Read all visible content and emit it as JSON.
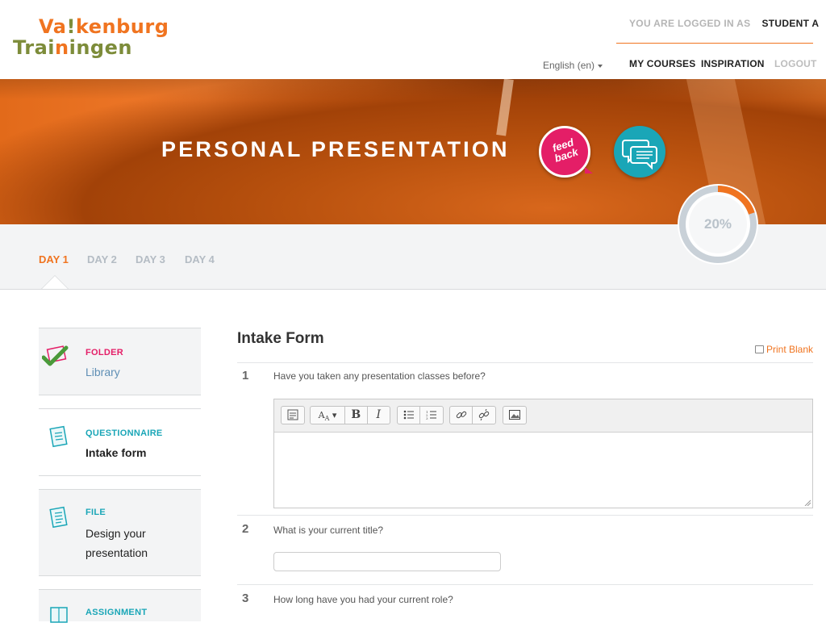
{
  "brand": {
    "line1_a": "Va",
    "line1_bang": "!",
    "line1_b": "kenburg",
    "line2_a": "Trai",
    "line2_i": "n",
    "line2_b": "ingen"
  },
  "header": {
    "logged_in_label": "YOU ARE LOGGED IN AS",
    "user": "STUDENT A",
    "language": "English (en)",
    "nav": {
      "my_courses": "MY COURSES",
      "inspiration": "INSPIRATION",
      "logout": "LOGOUT"
    }
  },
  "hero": {
    "title": "PERSONAL PRESENTATION",
    "feedback_badge": "feed back",
    "chat_icon": "chat-bubbles-icon"
  },
  "progress": {
    "label": "20%",
    "value": 0.2,
    "color": "#f07420",
    "track_color": "#c9d1d8"
  },
  "days": {
    "tabs": [
      "DAY 1",
      "DAY 2",
      "DAY 3",
      "DAY 4"
    ],
    "active": 0
  },
  "sidebar": {
    "items": [
      {
        "type": "FOLDER",
        "title": "Library",
        "type_color": "#e41e67",
        "icon": "checkmark-icon"
      },
      {
        "type": "QUESTIONNAIRE",
        "title": "Intake form",
        "type_color": "#1aa6b7",
        "icon": "questionnaire-icon"
      },
      {
        "type": "FILE",
        "title": "Design your presentation",
        "title_l1": "Design your",
        "title_l2": "presentation",
        "type_color": "#1aa6b7",
        "icon": "file-icon"
      },
      {
        "type": "ASSIGNMENT",
        "title": "",
        "type_color": "#1aa6b7",
        "icon": "assignment-icon"
      }
    ]
  },
  "form": {
    "title": "Intake Form",
    "print_label": "Print Blank",
    "questions": [
      {
        "number": "1",
        "text": "Have you taken any presentation classes before?",
        "answer": ""
      },
      {
        "number": "2",
        "text": "What is your current title?",
        "answer": ""
      },
      {
        "number": "3",
        "text": "How long have you had your current role?",
        "answer": ""
      }
    ],
    "toolbar": {
      "buttons": [
        "html-view-icon",
        "font-size-icon",
        "bold-icon",
        "italic-icon",
        "bullet-list-icon",
        "numbered-list-icon",
        "link-icon",
        "unlink-icon",
        "image-icon"
      ],
      "bold": "B",
      "italic": "I"
    }
  }
}
